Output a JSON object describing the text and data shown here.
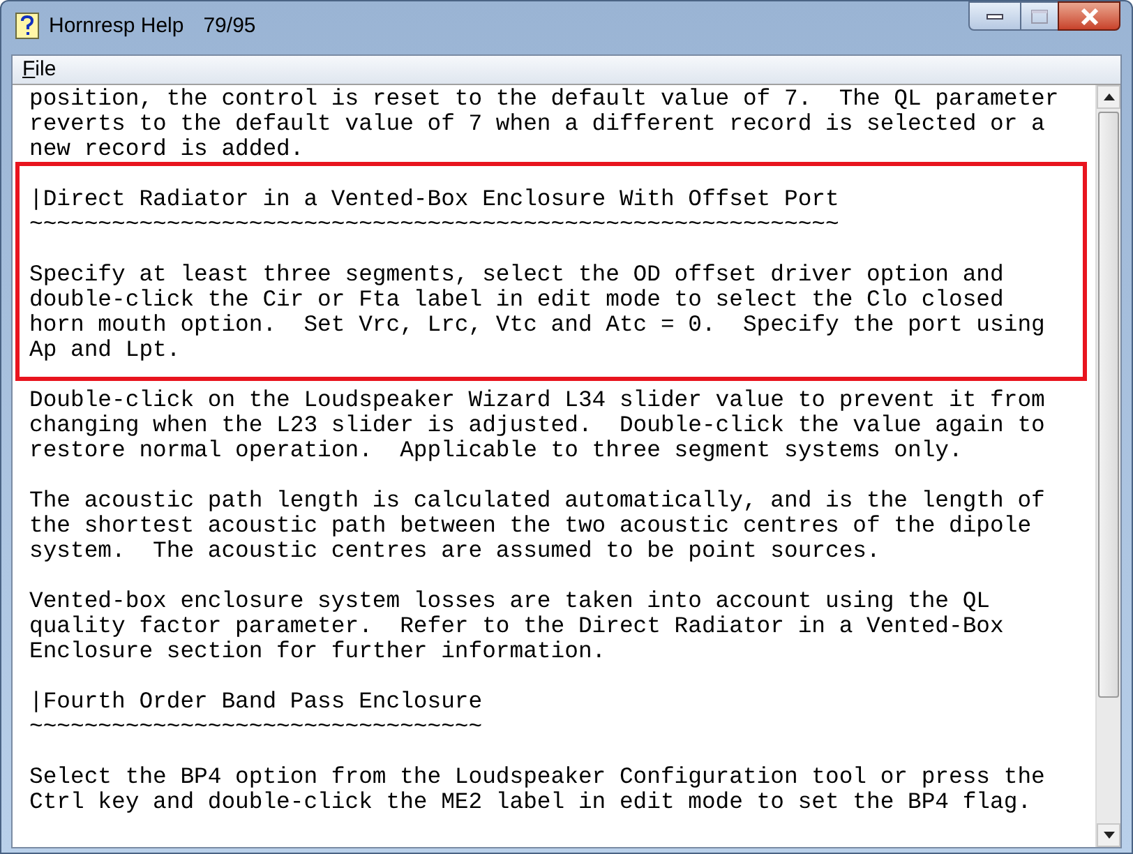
{
  "window": {
    "title": "Hornresp Help",
    "page": "79/95"
  },
  "menu": [
    {
      "label": "File"
    }
  ],
  "blocks": [
    {
      "highlighted": false,
      "paragraphs": [
        {
          "lines": [
            "position, the control is reset to the default value of 7.  The QL parameter",
            "reverts to the default value of 7 when a different record is selected or a",
            "new record is added."
          ]
        }
      ]
    },
    {
      "highlighted": true,
      "paragraphs": [
        {
          "lines": [
            "|Direct Radiator in a Vented-Box Enclosure With Offset Port",
            "~~~~~~~~~~~~~~~~~~~~~~~~~~~~~~~~~~~~~~~~~~~~~~~~~~~~~~~~~~~"
          ]
        },
        {
          "lines": [
            "Specify at least three segments, select the OD offset driver option and",
            "double-click the Cir or Fta label in edit mode to select the Clo closed",
            "horn mouth option.  Set Vrc, Lrc, Vtc and Atc = 0.  Specify the port using",
            "Ap and Lpt."
          ]
        }
      ]
    },
    {
      "highlighted": false,
      "paragraphs": [
        {
          "lines": [
            "Double-click on the Loudspeaker Wizard L34 slider value to prevent it from",
            "changing when the L23 slider is adjusted.  Double-click the value again to",
            "restore normal operation.  Applicable to three segment systems only."
          ]
        },
        {
          "lines": [
            "The acoustic path length is calculated automatically, and is the length of",
            "the shortest acoustic path between the two acoustic centres of the dipole",
            "system.  The acoustic centres are assumed to be point sources."
          ]
        },
        {
          "lines": [
            "Vented-box enclosure system losses are taken into account using the QL",
            "quality factor parameter.  Refer to the Direct Radiator in a Vented-Box",
            "Enclosure section for further information."
          ]
        },
        {
          "lines": [
            "|Fourth Order Band Pass Enclosure",
            "~~~~~~~~~~~~~~~~~~~~~~~~~~~~~~~~~"
          ]
        },
        {
          "lines": [
            "Select the BP4 option from the Loudspeaker Configuration tool or press the",
            "Ctrl key and double-click the ME2 label in edit mode to set the BP4 flag."
          ]
        }
      ]
    }
  ]
}
